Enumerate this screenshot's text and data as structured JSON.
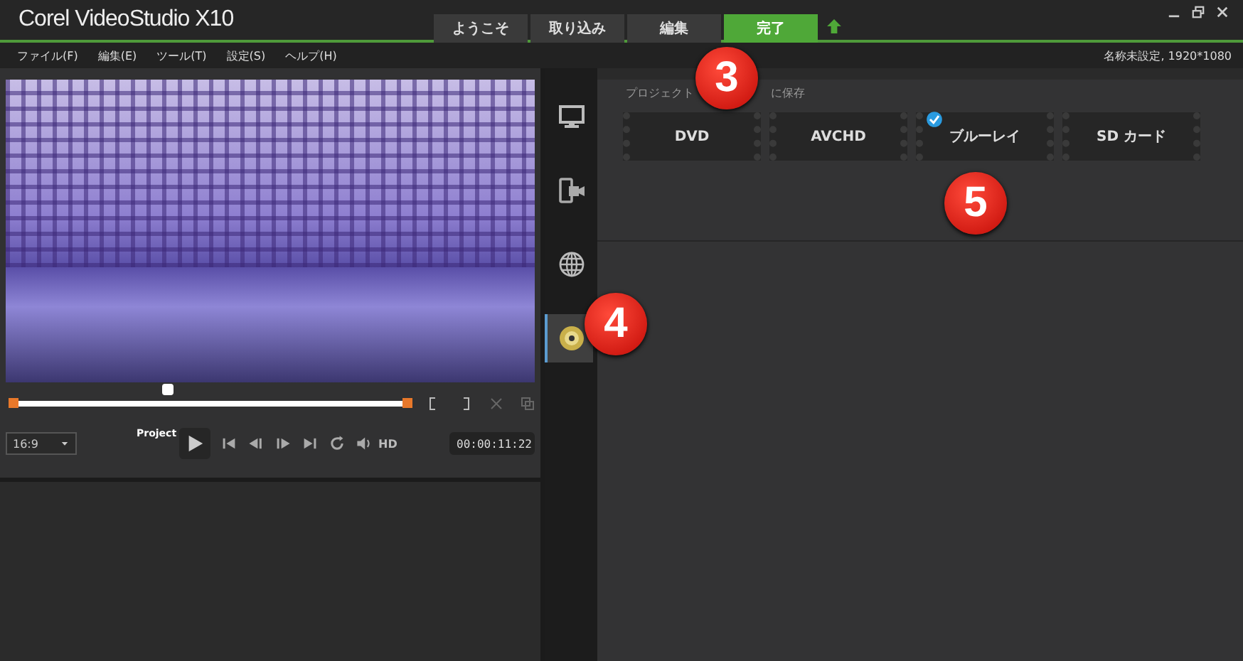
{
  "window": {
    "title": "Corel VideoStudio X10"
  },
  "tabs": [
    {
      "label": "ようこそ",
      "selected": false
    },
    {
      "label": "取り込み",
      "selected": false
    },
    {
      "label": "編集",
      "selected": false
    },
    {
      "label": "完了",
      "selected": true
    }
  ],
  "menu": [
    "ファイル(F)",
    "編集(E)",
    "ツール(T)",
    "設定(S)",
    "ヘルプ(H)"
  ],
  "project_info": "名称未設定, 1920*1080",
  "player": {
    "scrubber": {
      "level": 0.39
    },
    "aspect": "16:9",
    "mode_label": "Project",
    "hd": "HD",
    "timecode": "00:00:11:22"
  },
  "side_tabs": [
    {
      "kind": "monitor",
      "selected": false
    },
    {
      "kind": "device",
      "selected": false
    },
    {
      "kind": "web",
      "selected": false
    },
    {
      "kind": "disc",
      "selected": true
    }
  ],
  "output": {
    "heading": [
      "プロジェクト",
      "に保存"
    ],
    "options": [
      {
        "label": "DVD",
        "checked": false
      },
      {
        "label": "AVCHD",
        "checked": false
      },
      {
        "label": "ブルーレイ",
        "checked": true
      },
      {
        "label": "SD カード",
        "checked": false
      }
    ]
  },
  "callouts": [
    "3",
    "4",
    "5"
  ]
}
